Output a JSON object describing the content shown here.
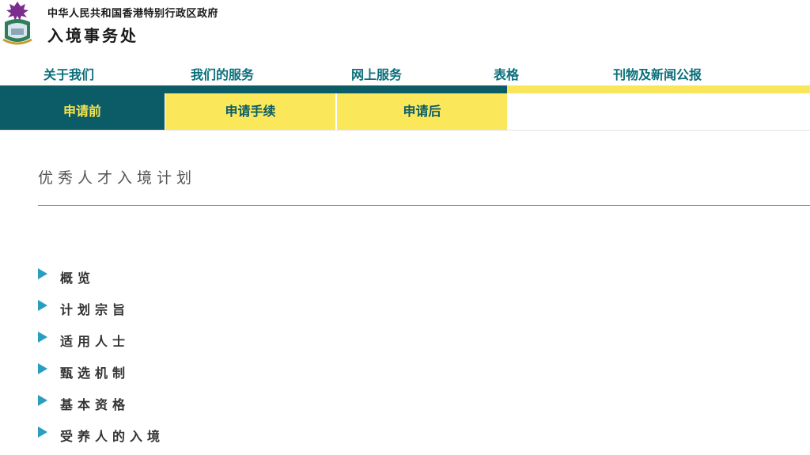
{
  "header": {
    "gov_name": "中华人民共和国香港特别行政区政府",
    "dept_name": "入境事务处"
  },
  "mainnav": {
    "items": [
      {
        "label": "关于我们"
      },
      {
        "label": "我们的服务"
      },
      {
        "label": "网上服务"
      },
      {
        "label": "表格"
      },
      {
        "label": "刊物及新闻公报"
      }
    ]
  },
  "subtabs": {
    "items": [
      {
        "label": "申请前",
        "active": true
      },
      {
        "label": "申请手续",
        "active": false
      },
      {
        "label": "申请后",
        "active": false
      }
    ]
  },
  "page": {
    "title": "优秀人才入境计划"
  },
  "menu": {
    "items": [
      {
        "label": "概览"
      },
      {
        "label": "计划宗旨"
      },
      {
        "label": "适用人士"
      },
      {
        "label": "甄选机制"
      },
      {
        "label": "基本资格"
      },
      {
        "label": "受养人的入境"
      }
    ]
  },
  "colors": {
    "teal": "#0b5c67",
    "yellow": "#f9e65b",
    "nav_text": "#0a6f7a",
    "bullet": "#2a9ec0"
  }
}
